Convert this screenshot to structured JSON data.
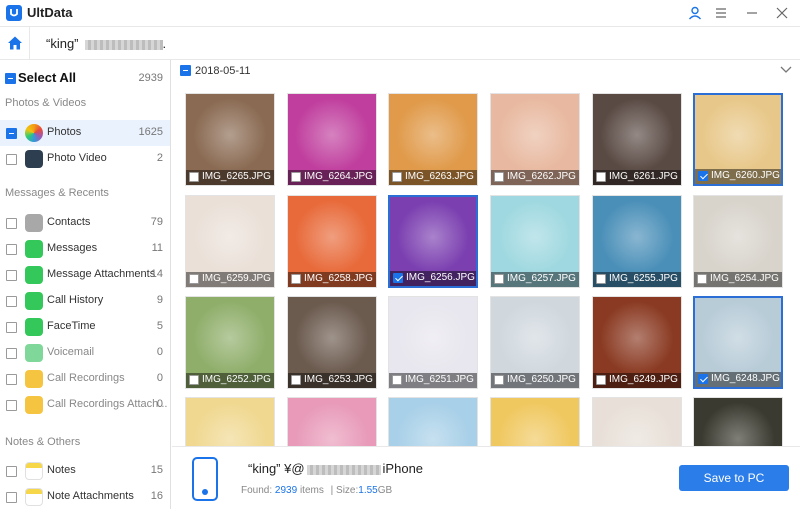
{
  "app": {
    "title": "UltData"
  },
  "nav": {
    "device_name": "“king”",
    "device_suffix": "."
  },
  "sidebar": {
    "select_all": {
      "label": "Select All",
      "count": "2939"
    },
    "sections": [
      {
        "title": "Photos & Videos"
      },
      {
        "title": "Messages & Recents"
      },
      {
        "title": "Notes & Others"
      }
    ],
    "items": [
      {
        "label": "Photos",
        "count": "1625",
        "color": "#f39c12"
      },
      {
        "label": "Photo Video",
        "count": "2",
        "color": "#2c3e50"
      },
      {
        "label": "Contacts",
        "count": "79",
        "color": "#9e9e9e"
      },
      {
        "label": "Messages",
        "count": "11",
        "color": "#34c759"
      },
      {
        "label": "Message Attachments",
        "count": "14",
        "color": "#34c759"
      },
      {
        "label": "Call History",
        "count": "9",
        "color": "#34c759"
      },
      {
        "label": "FaceTime",
        "count": "5",
        "color": "#34c759"
      },
      {
        "label": "Voicemail",
        "count": "0",
        "color": "#34c759"
      },
      {
        "label": "Call Recordings",
        "count": "0",
        "color": "#f5b400"
      },
      {
        "label": "Call Recordings Attach...",
        "count": "0",
        "color": "#f5b400"
      },
      {
        "label": "Notes",
        "count": "15",
        "color": "#f7d74a"
      },
      {
        "label": "Note Attachments",
        "count": "16",
        "color": "#f7d74a"
      }
    ]
  },
  "main": {
    "date_group": "2018-05-11",
    "photos": [
      {
        "name": "IMG_6265.JPG",
        "selected": false,
        "bg": "#8a6a52"
      },
      {
        "name": "IMG_6264.JPG",
        "selected": false,
        "bg": "#c03f9e"
      },
      {
        "name": "IMG_6263.JPG",
        "selected": false,
        "bg": "#e09a4a"
      },
      {
        "name": "IMG_6262.JPG",
        "selected": false,
        "bg": "#e8b9a0"
      },
      {
        "name": "IMG_6261.JPG",
        "selected": false,
        "bg": "#5a4a44"
      },
      {
        "name": "IMG_6260.JPG",
        "selected": true,
        "bg": "#e8c88a"
      },
      {
        "name": "IMG_6259.JPG",
        "selected": false,
        "bg": "#eae0d8"
      },
      {
        "name": "IMG_6258.JPG",
        "selected": false,
        "bg": "#e86a3a"
      },
      {
        "name": "IMG_6256.JPG",
        "selected": true,
        "bg": "#7b3fb0"
      },
      {
        "name": "IMG_6257.JPG",
        "selected": false,
        "bg": "#9fd8e0"
      },
      {
        "name": "IMG_6255.JPG",
        "selected": false,
        "bg": "#4a8fb8"
      },
      {
        "name": "IMG_6254.JPG",
        "selected": false,
        "bg": "#d8d4cc"
      },
      {
        "name": "IMG_6252.JPG",
        "selected": false,
        "bg": "#8fae6a"
      },
      {
        "name": "IMG_6253.JPG",
        "selected": false,
        "bg": "#6b5a4e"
      },
      {
        "name": "IMG_6251.JPG",
        "selected": false,
        "bg": "#e8e6ee"
      },
      {
        "name": "IMG_6250.JPG",
        "selected": false,
        "bg": "#d0d8de"
      },
      {
        "name": "IMG_6249.JPG",
        "selected": false,
        "bg": "#8a3a22"
      },
      {
        "name": "IMG_6248.JPG",
        "selected": true,
        "bg": "#b8ccd8"
      },
      {
        "name": "",
        "selected": false,
        "bg": "#f0d890"
      },
      {
        "name": "",
        "selected": false,
        "bg": "#e89ab8"
      },
      {
        "name": "",
        "selected": false,
        "bg": "#a8d0e8"
      },
      {
        "name": "",
        "selected": false,
        "bg": "#f0c860"
      },
      {
        "name": "",
        "selected": false,
        "bg": "#e8e0d8"
      },
      {
        "name": "",
        "selected": false,
        "bg": "#3a3a30"
      }
    ]
  },
  "footer": {
    "device_name": "“king” ¥@",
    "device_model": "iPhone",
    "found_label": "Found:",
    "found_count": "2939",
    "found_unit": "items",
    "size_label": "Size:",
    "size_value": "1.55",
    "size_unit": "GB",
    "save_button": "Save to PC"
  },
  "colors": {
    "accent": "#1a73e8",
    "selected_bg": "#eaf2fd"
  }
}
